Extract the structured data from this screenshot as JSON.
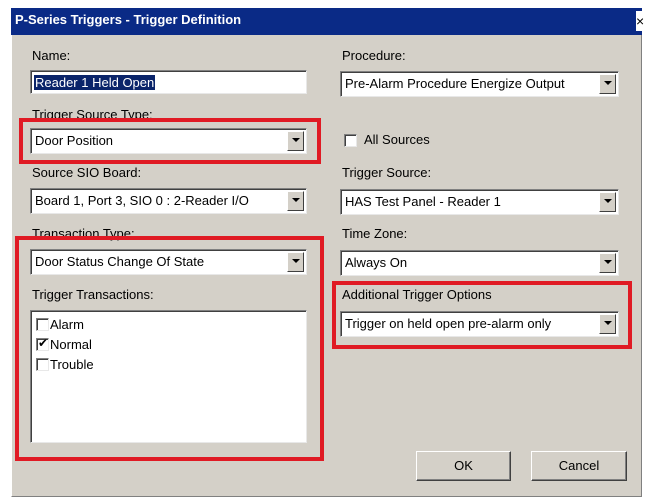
{
  "window": {
    "title": "P-Series Triggers - Trigger Definition",
    "close": "×"
  },
  "name": {
    "label": "Name:",
    "value": "Reader 1 Held Open"
  },
  "trigger_source_type": {
    "label": "Trigger Source Type:",
    "value": "Door Position"
  },
  "source_sio_board": {
    "label": "Source SIO Board:",
    "value": "Board 1, Port 3, SIO 0 : 2-Reader I/O"
  },
  "transaction_type": {
    "label": "Transaction Type:",
    "value": "Door Status Change Of State"
  },
  "trigger_transactions": {
    "label": "Trigger Transactions:",
    "items": [
      {
        "label": "Alarm",
        "checked": false
      },
      {
        "label": "Normal",
        "checked": true
      },
      {
        "label": "Trouble",
        "checked": false
      }
    ]
  },
  "procedure": {
    "label": "Procedure:",
    "value": "Pre-Alarm Procedure Energize Output"
  },
  "all_sources": {
    "label": "All Sources",
    "checked": false
  },
  "trigger_source": {
    "label": "Trigger Source:",
    "value": "HAS Test Panel - Reader 1"
  },
  "time_zone": {
    "label": "Time Zone:",
    "value": "Always On"
  },
  "additional_options": {
    "label": "Additional Trigger Options",
    "value": "Trigger on held open pre-alarm only"
  },
  "buttons": {
    "ok": "OK",
    "cancel": "Cancel"
  },
  "colors": {
    "titlebar": "#0a2a86",
    "highlight": "#e01a24",
    "dialog": "#d4d0c8"
  }
}
